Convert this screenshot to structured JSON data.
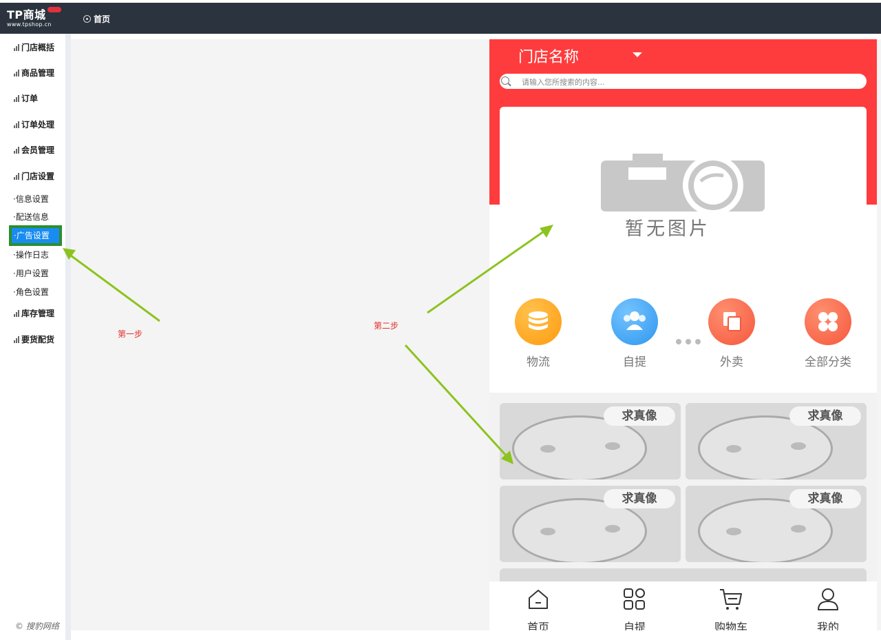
{
  "header": {
    "logo_main": "TP商城",
    "logo_sub": "www.tpshop.cn",
    "home_label": "首页"
  },
  "sidebar": {
    "items": [
      {
        "label": "门店概括"
      },
      {
        "label": "商品管理"
      },
      {
        "label": "订单"
      },
      {
        "label": "订单处理"
      },
      {
        "label": "会员管理"
      },
      {
        "label": "门店设置"
      }
    ],
    "subitems": [
      {
        "label": "·信息设置"
      },
      {
        "label": "·配送信息"
      },
      {
        "label": "·广告设置",
        "active": true
      },
      {
        "label": "·操作日志"
      },
      {
        "label": "·用户设置"
      },
      {
        "label": "·角色设置"
      }
    ],
    "items_after": [
      {
        "label": "库存管理"
      },
      {
        "label": "要货配货"
      }
    ],
    "copyright": "© 搜豹网络"
  },
  "annotations": {
    "step1": "第一步",
    "step2": "第二步"
  },
  "phone": {
    "store_name": "门店名称",
    "search_placeholder": "请输入您所搜索的内容...",
    "banner_text": "暂无图片",
    "quick_icons": [
      {
        "label": "物流",
        "icon": "database-icon",
        "color": "#ffa31a"
      },
      {
        "label": "自提",
        "icon": "users-icon",
        "color": "#3fa6f5"
      },
      {
        "label": "外卖",
        "icon": "copy-icon",
        "color": "#ff6a4d"
      },
      {
        "label": "全部分类",
        "icon": "clover-icon",
        "color": "#ff6a4d"
      }
    ],
    "tile_caption": "求真像",
    "tabs": [
      {
        "label": "首页",
        "icon": "home-icon"
      },
      {
        "label": "自提",
        "icon": "grid-icon"
      },
      {
        "label": "购物车",
        "icon": "cart-icon"
      },
      {
        "label": "我的",
        "icon": "user-icon"
      }
    ]
  },
  "colors": {
    "topbar": "#2b333e",
    "phone_header": "#ff3c3d",
    "active_nav": "#1a8cf0",
    "arrow": "#8cc31f",
    "annotation_text": "#e52d2d"
  }
}
